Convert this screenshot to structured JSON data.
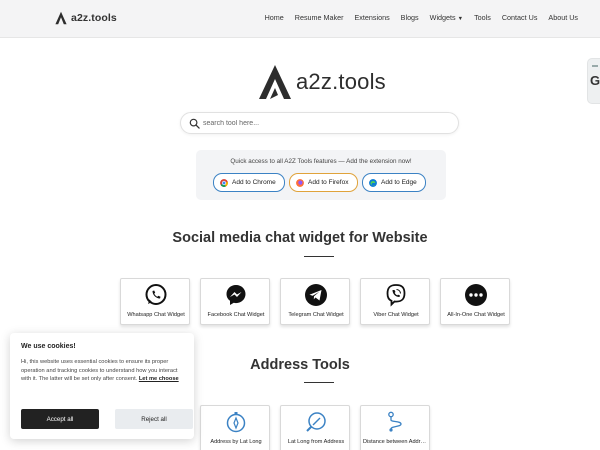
{
  "header": {
    "brand": "a2z.tools",
    "nav": [
      "Home",
      "Resume Maker",
      "Extensions",
      "Blogs",
      "Widgets",
      "Tools",
      "Contact Us",
      "About Us"
    ]
  },
  "side_tab": {
    "glyph": "G"
  },
  "hero": {
    "logo_text": "a2z.tools",
    "search_placeholder": "search tool here..."
  },
  "extensions": {
    "text": "Quick access to all A2Z Tools features — Add the extension now!",
    "buttons": [
      "Add to Chrome",
      "Add to Firefox",
      "Add to Edge"
    ]
  },
  "sections": [
    {
      "title": "Social media chat widget for Website",
      "cards": [
        {
          "label": "Whatsapp Chat Widget",
          "icon": "whatsapp-icon"
        },
        {
          "label": "Facebook Chat Widget",
          "icon": "messenger-icon"
        },
        {
          "label": "Telegram Chat Widget",
          "icon": "telegram-icon"
        },
        {
          "label": "Viber Chat Widget",
          "icon": "viber-icon"
        },
        {
          "label": "All-In-One Chat Widget",
          "icon": "chat-bubble-icon"
        }
      ]
    },
    {
      "title": "Address Tools",
      "cards": [
        {
          "label": "Address by Lat Long",
          "icon": "compass-icon"
        },
        {
          "label": "Lat Long from Address",
          "icon": "location-search-icon"
        },
        {
          "label": "Distance between Addresses",
          "icon": "route-icon"
        }
      ]
    }
  ],
  "cookie": {
    "title": "We use cookies!",
    "text": "Hi, this website uses essential cookies to ensure its proper operation and tracking cookies to understand how you interact with it. The latter will be set only after consent.",
    "link": "Let me choose",
    "accept": "Accept all",
    "reject": "Reject all"
  },
  "colors": {
    "header_bg": "#f4f4f5",
    "chrome_border": "#3b82c4",
    "firefox_border": "#e0a33b",
    "accept_bg": "#222222"
  }
}
